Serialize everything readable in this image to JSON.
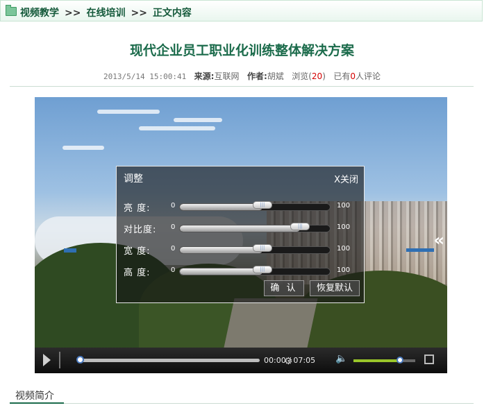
{
  "breadcrumb": {
    "items": [
      "视频教学",
      "在线培训",
      "正文内容"
    ],
    "separator": ">>"
  },
  "article": {
    "title": "现代企业员工职业化训练整体解决方案",
    "date": "2013/5/14 15:00:41",
    "source_label": "来源:",
    "source_value": "互联网",
    "author_label": "作者:",
    "author_value": "胡斌",
    "views_label": "浏览(",
    "views_count": "20",
    "views_close": ")",
    "comments_prefix": "已有",
    "comments_count": "0",
    "comments_suffix": "人评论"
  },
  "adjust_panel": {
    "title": "调整",
    "close_label": "X关闭",
    "rows": [
      {
        "label": "亮  度:",
        "min": "0",
        "max": "100",
        "level": 0.55
      },
      {
        "label": "对比度:",
        "min": "0",
        "max": "100",
        "level": 0.8
      },
      {
        "label": "宽  度:",
        "min": "0",
        "max": "100",
        "level": 0.55
      },
      {
        "label": "高  度:",
        "min": "0",
        "max": "100",
        "level": 0.55
      }
    ],
    "confirm_label": "确 认",
    "reset_label": "恢复默认"
  },
  "player": {
    "time": "00:00 / 07:05",
    "seek_progress": 0.0,
    "volume_level": 0.75,
    "side_arrow": "«"
  },
  "tabs": {
    "intro_label": "视频简介"
  },
  "colors": {
    "accent": "#1b6b4b",
    "highlight_red": "#d40000",
    "volume_green": "#9ac62a"
  }
}
